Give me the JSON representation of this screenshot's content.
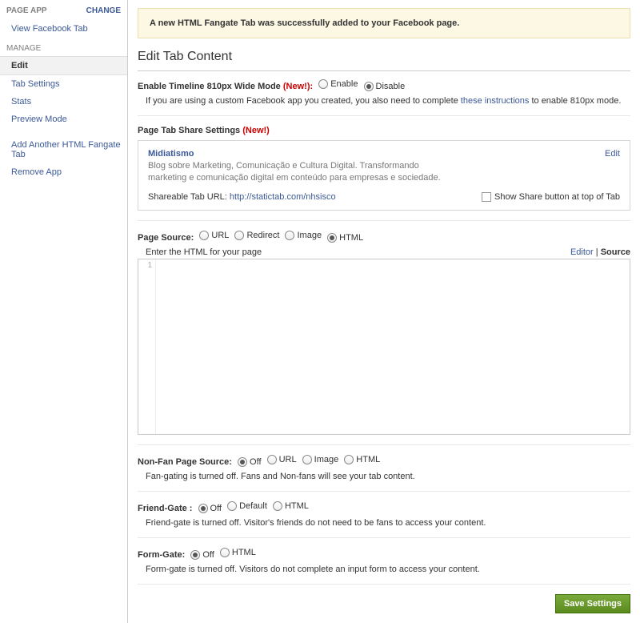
{
  "sidebar": {
    "header": "PAGE APP",
    "change": "CHANGE",
    "view_tab": "View Facebook Tab",
    "manage_label": "MANAGE",
    "items": {
      "edit": "Edit",
      "tab_settings": "Tab Settings",
      "stats": "Stats",
      "preview": "Preview Mode",
      "add_another": "Add Another HTML Fangate Tab",
      "remove": "Remove App"
    }
  },
  "flash": "A new HTML Fangate Tab was successfully added to your Facebook page.",
  "page_title": "Edit Tab Content",
  "wide_mode": {
    "label": "Enable Timeline 810px Wide Mode",
    "new": "(New!):",
    "enable": "Enable",
    "disable": "Disable",
    "help_prefix": "If you are using a custom Facebook app you created, you also need to complete ",
    "help_link": "these instructions",
    "help_suffix": " to enable 810px mode."
  },
  "share": {
    "label": "Page Tab Share Settings",
    "new": "(New!)",
    "page_name": "Midiatismo",
    "edit": "Edit",
    "desc": "Blog sobre Marketing, Comunicação e Cultura Digital. Transformando marketing e comunicação digital em conteúdo para empresas e sociedade.",
    "url_label": "Shareable Tab URL: ",
    "url": "http://statictab.com/nhsisco",
    "show_share": "Show Share button at top of Tab"
  },
  "page_source": {
    "label": "Page Source:",
    "url": "URL",
    "redirect": "Redirect",
    "image": "Image",
    "html": "HTML",
    "enter": "Enter the HTML for your page",
    "editor": "Editor",
    "source": "Source",
    "line1": "1"
  },
  "nonfan": {
    "label": "Non-Fan Page Source:",
    "off": "Off",
    "url": "URL",
    "image": "Image",
    "html": "HTML",
    "help": "Fan-gating is turned off. Fans and Non-fans will see your tab content."
  },
  "friend": {
    "label": "Friend-Gate :",
    "off": "Off",
    "default": "Default",
    "html": "HTML",
    "help": "Friend-gate is turned off. Visitor's friends do not need to be fans to access your content."
  },
  "form": {
    "label": "Form-Gate:",
    "off": "Off",
    "html": "HTML",
    "help": "Form-gate is turned off. Visitors do not complete an input form to access your content."
  },
  "save": "Save Settings",
  "sep": " | "
}
